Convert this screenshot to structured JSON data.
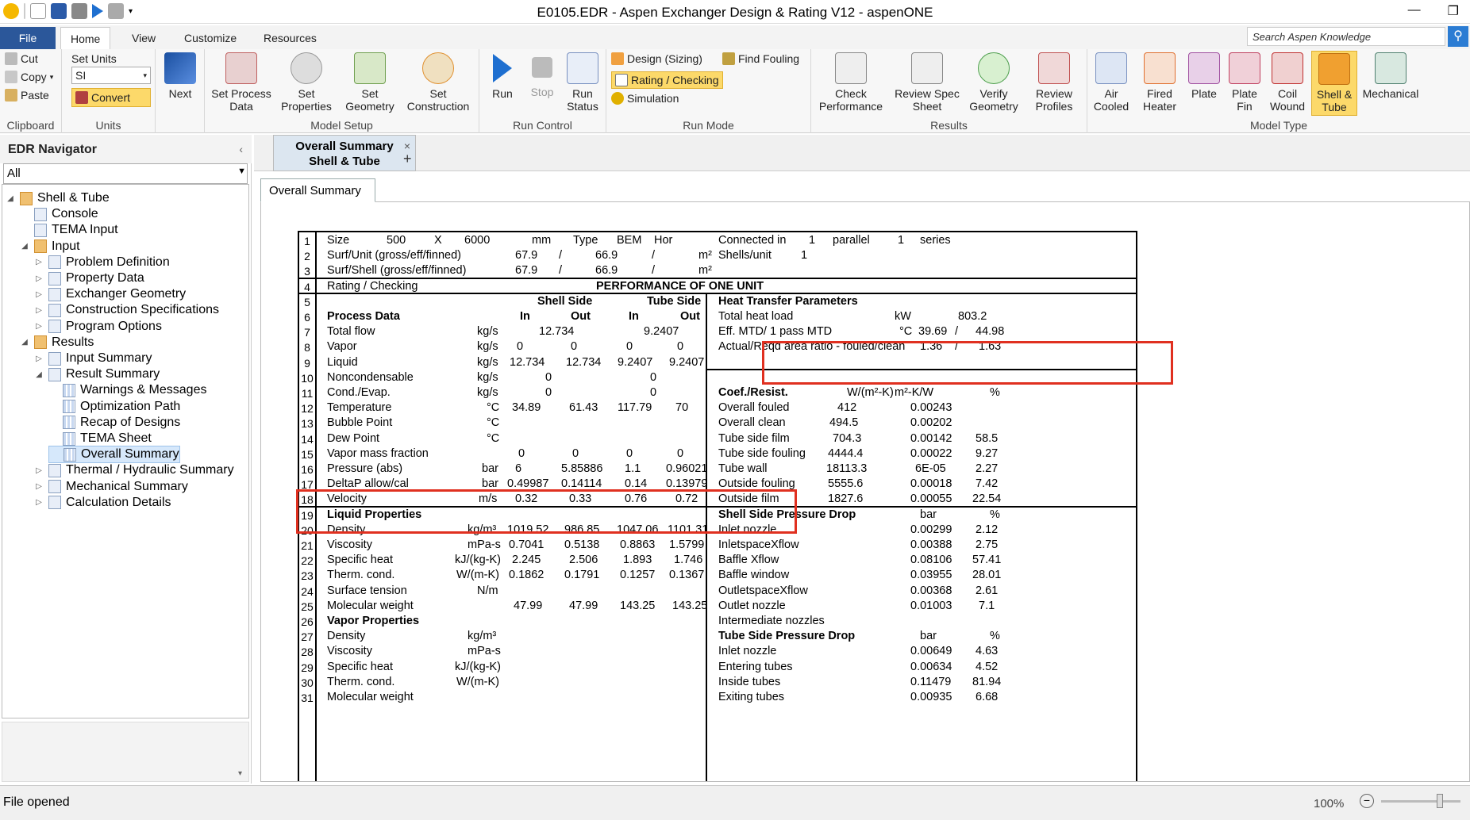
{
  "titlebar": {
    "title": "E0105.EDR - Aspen Exchanger Design & Rating V12 - aspenONE",
    "restore": "❐",
    "minimize": "—"
  },
  "ribbon_tabs": {
    "file": "File",
    "home": "Home",
    "view": "View",
    "customize": "Customize",
    "resources": "Resources"
  },
  "search": {
    "placeholder": "Search Aspen Knowledge"
  },
  "clipboard": {
    "cut": "Cut",
    "copy": "Copy",
    "paste": "Paste",
    "label": "Clipboard"
  },
  "units": {
    "set_units": "Set Units",
    "value": "SI",
    "convert": "Convert",
    "label": "Units"
  },
  "next": "Next",
  "model_setup": {
    "process": "Set Process\nData",
    "properties": "Set\nProperties",
    "geometry": "Set\nGeometry",
    "construction": "Set\nConstruction",
    "label": "Model Setup"
  },
  "run_control": {
    "run": "Run",
    "stop": "Stop",
    "status": "Run\nStatus",
    "label": "Run Control"
  },
  "run_mode": {
    "design": "Design (Sizing)",
    "rating": "Rating / Checking",
    "simulation": "Simulation",
    "find_fouling": "Find Fouling",
    "label": "Run Mode"
  },
  "results": {
    "check": "Check\nPerformance",
    "review_spec": "Review Spec\nSheet",
    "verify": "Verify\nGeometry",
    "review_profiles": "Review\nProfiles",
    "label": "Results"
  },
  "model_type": {
    "air": "Air\nCooled",
    "fired": "Fired\nHeater",
    "plate": "Plate",
    "platefin": "Plate\nFin",
    "coil": "Coil\nWound",
    "shelltube": "Shell &\nTube",
    "mechanical": "Mechanical",
    "label": "Model Type"
  },
  "navigator": {
    "title": "EDR Navigator",
    "collapse": "‹",
    "filter": "All"
  },
  "tree": [
    {
      "label": "Shell & Tube",
      "level": 0,
      "arrow": "◢",
      "icon": "folder"
    },
    {
      "label": "Console",
      "level": 1,
      "arrow": "",
      "icon": "doc"
    },
    {
      "label": "TEMA Input",
      "level": 1,
      "arrow": "",
      "icon": "doc"
    },
    {
      "label": "Input",
      "level": 1,
      "arrow": "◢",
      "icon": "folder"
    },
    {
      "label": "Problem Definition",
      "level": 2,
      "arrow": "▷",
      "icon": "doc"
    },
    {
      "label": "Property Data",
      "level": 2,
      "arrow": "▷",
      "icon": "doc"
    },
    {
      "label": "Exchanger Geometry",
      "level": 2,
      "arrow": "▷",
      "icon": "doc"
    },
    {
      "label": "Construction Specifications",
      "level": 2,
      "arrow": "▷",
      "icon": "doc"
    },
    {
      "label": "Program Options",
      "level": 2,
      "arrow": "▷",
      "icon": "doc"
    },
    {
      "label": "Results",
      "level": 1,
      "arrow": "◢",
      "icon": "folder"
    },
    {
      "label": "Input Summary",
      "level": 2,
      "arrow": "▷",
      "icon": "doc"
    },
    {
      "label": "Result Summary",
      "level": 2,
      "arrow": "◢",
      "icon": "doc"
    },
    {
      "label": "Warnings & Messages",
      "level": 3,
      "arrow": "",
      "icon": "grid"
    },
    {
      "label": "Optimization Path",
      "level": 3,
      "arrow": "",
      "icon": "grid"
    },
    {
      "label": "Recap of Designs",
      "level": 3,
      "arrow": "",
      "icon": "grid"
    },
    {
      "label": "TEMA Sheet",
      "level": 3,
      "arrow": "",
      "icon": "grid"
    },
    {
      "label": "Overall Summary",
      "level": 3,
      "arrow": "",
      "icon": "grid",
      "selected": true
    },
    {
      "label": "Thermal / Hydraulic Summary",
      "level": 2,
      "arrow": "▷",
      "icon": "doc"
    },
    {
      "label": "Mechanical Summary",
      "level": 2,
      "arrow": "▷",
      "icon": "doc"
    },
    {
      "label": "Calculation Details",
      "level": 2,
      "arrow": "▷",
      "icon": "doc"
    }
  ],
  "doc_tab": {
    "line1": "Overall Summary",
    "line2": "Shell & Tube",
    "close": "×",
    "add": "+"
  },
  "sub_tab": "Overall Summary",
  "sheet_rows": [
    {
      "n": "1",
      "cells": [
        [
          "Size",
          35
        ],
        [
          "500",
          110
        ],
        [
          "X",
          170
        ],
        [
          "6000",
          208
        ],
        [
          "mm",
          293
        ],
        [
          "Type",
          345
        ],
        [
          "BEM",
          400
        ],
        [
          "Hor",
          447
        ],
        [
          "Connected in",
          528
        ],
        [
          "1",
          642
        ],
        [
          "parallel",
          672
        ],
        [
          "1",
          754
        ],
        [
          "series",
          782
        ]
      ]
    },
    {
      "n": "2",
      "cells": [
        [
          "Surf/Unit (gross/eff/finned)",
          35
        ],
        [
          "67.9",
          272
        ],
        [
          "/",
          327
        ],
        [
          "66.9",
          373
        ],
        [
          "/",
          444
        ],
        [
          "m²",
          503
        ],
        [
          "Shells/unit",
          528
        ],
        [
          "1",
          632
        ]
      ]
    },
    {
      "n": "3",
      "cells": [
        [
          "Surf/Shell (gross/eff/finned)",
          35
        ],
        [
          "67.9",
          272
        ],
        [
          "/",
          327
        ],
        [
          "66.9",
          373
        ],
        [
          "/",
          444
        ],
        [
          "m²",
          503
        ]
      ]
    },
    {
      "n": "4",
      "cells": [
        [
          "Rating / Checking",
          35
        ]
      ],
      "bold": [
        [
          "PERFORMANCE OF ONE UNIT",
          374
        ]
      ]
    },
    {
      "n": "5",
      "bold": [
        [
          "Shell Side",
          300
        ],
        [
          "Tube Side",
          438
        ],
        [
          "Heat Transfer Parameters",
          528
        ]
      ]
    },
    {
      "n": "6",
      "bold": [
        [
          "Process Data",
          35
        ],
        [
          "In",
          278
        ],
        [
          "Out",
          342
        ],
        [
          "In",
          415
        ],
        [
          "Out",
          480
        ]
      ],
      "cells": [
        [
          "Total heat load",
          528
        ],
        [
          "kW",
          750
        ],
        [
          "803.2",
          830
        ]
      ]
    },
    {
      "n": "7",
      "cells": [
        [
          "Total flow",
          35
        ],
        [
          "kg/s",
          224
        ],
        [
          "12.734",
          302
        ],
        [
          "9.2407",
          434
        ],
        [
          "Eff. MTD/ 1 pass MTD",
          528
        ],
        [
          "°C",
          756
        ],
        [
          "39.69",
          780
        ],
        [
          "/",
          826
        ],
        [
          "44.98",
          852
        ]
      ]
    },
    {
      "n": "8",
      "cells": [
        [
          "Vapor",
          35
        ],
        [
          "kg/s",
          224
        ],
        [
          "0",
          274
        ],
        [
          "0",
          342
        ],
        [
          "0",
          412
        ],
        [
          "0",
          476
        ],
        [
          "Actual/Reqd area ratio - fouled/clean",
          528
        ],
        [
          "1.36",
          782
        ],
        [
          "/",
          826
        ],
        [
          "1.63",
          856
        ]
      ]
    },
    {
      "n": "9",
      "cells": [
        [
          "Liquid",
          35
        ],
        [
          "kg/s",
          224
        ],
        [
          "12.734",
          265
        ],
        [
          "12.734",
          336
        ],
        [
          "9.2407",
          401
        ],
        [
          "9.2407",
          466
        ]
      ]
    },
    {
      "n": "10",
      "cells": [
        [
          "Noncondensable",
          35
        ],
        [
          "kg/s",
          224
        ],
        [
          "0",
          310
        ],
        [
          "0",
          442
        ]
      ]
    },
    {
      "n": "11",
      "cells": [
        [
          "Cond./Evap.",
          35
        ],
        [
          "kg/s",
          224
        ],
        [
          "0",
          310
        ],
        [
          "0",
          442
        ]
      ],
      "bold": [
        [
          "Coef./Resist.",
          528
        ]
      ],
      "cells2": [
        [
          "W/(m²-K)",
          690
        ],
        [
          "m²-K/W",
          750
        ],
        [
          "%",
          870
        ]
      ]
    },
    {
      "n": "12",
      "cells": [
        [
          "Temperature",
          35
        ],
        [
          "°C",
          236
        ],
        [
          "34.89",
          268
        ],
        [
          "61.43",
          340
        ],
        [
          "117.79",
          401
        ],
        [
          "70",
          474
        ],
        [
          "Overall fouled",
          528
        ],
        [
          "412",
          678
        ],
        [
          "0.00243",
          770
        ]
      ]
    },
    {
      "n": "13",
      "cells": [
        [
          "Bubble Point",
          35
        ],
        [
          "°C",
          236
        ],
        [
          "Overall clean",
          528
        ],
        [
          "494.5",
          668
        ],
        [
          "0.00202",
          770
        ]
      ]
    },
    {
      "n": "14",
      "cells": [
        [
          "Dew Point",
          35
        ],
        [
          "°C",
          236
        ],
        [
          "Tube side film",
          528
        ],
        [
          "704.3",
          672
        ],
        [
          "0.00142",
          770
        ],
        [
          "58.5",
          852
        ]
      ]
    },
    {
      "n": "15",
      "cells": [
        [
          "Vapor mass fraction",
          35
        ],
        [
          "0",
          276
        ],
        [
          "0",
          344
        ],
        [
          "0",
          412
        ],
        [
          "0",
          476
        ],
        [
          "Tube side fouling",
          528
        ],
        [
          "4444.4",
          666
        ],
        [
          "0.00022",
          770
        ],
        [
          "9.27",
          852
        ]
      ]
    },
    {
      "n": "16",
      "cells": [
        [
          "Pressure (abs)",
          35
        ],
        [
          "bar",
          230
        ],
        [
          "6",
          272
        ],
        [
          "5.85886",
          330
        ],
        [
          "1.1",
          410
        ],
        [
          "0.96021",
          462
        ],
        [
          "Tube wall",
          528
        ],
        [
          "18113.3",
          664
        ],
        [
          "6E-05",
          776
        ],
        [
          "2.27",
          852
        ]
      ]
    },
    {
      "n": "17",
      "cells": [
        [
          "DeltaP allow/cal",
          35
        ],
        [
          "bar",
          230
        ],
        [
          "0.49987",
          262
        ],
        [
          "0.14114",
          330
        ],
        [
          "0.14",
          410
        ],
        [
          "0.13979",
          462
        ],
        [
          "Outside fouling",
          528
        ],
        [
          "5555.6",
          666
        ],
        [
          "0.00018",
          770
        ],
        [
          "7.42",
          852
        ]
      ]
    },
    {
      "n": "18",
      "cells": [
        [
          "Velocity",
          35
        ],
        [
          "m/s",
          226
        ],
        [
          "0.32",
          272
        ],
        [
          "0.33",
          340
        ],
        [
          "0.76",
          410
        ],
        [
          "0.72",
          474
        ],
        [
          "Outside film",
          528
        ],
        [
          "1827.6",
          666
        ],
        [
          "0.00055",
          770
        ],
        [
          "22.54",
          848
        ]
      ]
    },
    {
      "n": "19",
      "bold": [
        [
          "Liquid Properties",
          35
        ],
        [
          "Shell Side Pressure Drop",
          528
        ]
      ],
      "cells": [
        [
          "bar",
          782
        ],
        [
          "%",
          870
        ]
      ]
    },
    {
      "n": "20",
      "cells": [
        [
          "Density",
          35
        ],
        [
          "kg/m³",
          212
        ],
        [
          "1019.52",
          262
        ],
        [
          "986.85",
          334
        ],
        [
          "1047.06",
          400
        ],
        [
          "1101.31",
          464
        ],
        [
          "Inlet nozzle",
          528
        ],
        [
          "0.00299",
          770
        ],
        [
          "2.12",
          852
        ]
      ]
    },
    {
      "n": "21",
      "cells": [
        [
          "Viscosity",
          35
        ],
        [
          "mPa-s",
          212
        ],
        [
          "0.7041",
          264
        ],
        [
          "0.5138",
          334
        ],
        [
          "0.8863",
          404
        ],
        [
          "1.5799",
          466
        ],
        [
          "InletspaceXflow",
          528
        ],
        [
          "0.00388",
          770
        ],
        [
          "2.75",
          852
        ]
      ]
    },
    {
      "n": "22",
      "cells": [
        [
          "Specific heat",
          35
        ],
        [
          "kJ/(kg-K)",
          196
        ],
        [
          "2.245",
          268
        ],
        [
          "2.506",
          340
        ],
        [
          "1.893",
          408
        ],
        [
          "1.746",
          472
        ],
        [
          "Baffle Xflow",
          528
        ],
        [
          "0.08106",
          770
        ],
        [
          "57.41",
          848
        ]
      ]
    },
    {
      "n": "23",
      "cells": [
        [
          "Therm. cond.",
          35
        ],
        [
          "W/(m-K)",
          198
        ],
        [
          "0.1862",
          264
        ],
        [
          "0.1791",
          334
        ],
        [
          "0.1257",
          404
        ],
        [
          "0.1367",
          466
        ],
        [
          "Baffle window",
          528
        ],
        [
          "0.03955",
          770
        ],
        [
          "28.01",
          848
        ]
      ]
    },
    {
      "n": "24",
      "cells": [
        [
          "Surface tension",
          35
        ],
        [
          "N/m",
          224
        ],
        [
          "OutletspaceXflow",
          528
        ],
        [
          "0.00368",
          770
        ],
        [
          "2.61",
          852
        ]
      ]
    },
    {
      "n": "25",
      "cells": [
        [
          "Molecular weight",
          35
        ],
        [
          "47.99",
          270
        ],
        [
          "47.99",
          340
        ],
        [
          "143.25",
          404
        ],
        [
          "143.25",
          470
        ],
        [
          "Outlet nozzle",
          528
        ],
        [
          "0.01003",
          770
        ],
        [
          "7.1",
          856
        ]
      ]
    },
    {
      "n": "26",
      "bold": [
        [
          "Vapor Properties",
          35
        ]
      ],
      "cells": [
        [
          "Intermediate nozzles",
          528
        ]
      ]
    },
    {
      "n": "27",
      "cells": [
        [
          "Density",
          35
        ],
        [
          "kg/m³",
          212
        ],
        [
          "bar",
          782
        ],
        [
          "%",
          870
        ]
      ],
      "bold": [
        [
          "Tube Side Pressure Drop",
          528
        ]
      ]
    },
    {
      "n": "28",
      "cells": [
        [
          "Viscosity",
          35
        ],
        [
          "mPa-s",
          212
        ],
        [
          "Inlet nozzle",
          528
        ],
        [
          "0.00649",
          770
        ],
        [
          "4.63",
          852
        ]
      ]
    },
    {
      "n": "29",
      "cells": [
        [
          "Specific heat",
          35
        ],
        [
          "kJ/(kg-K)",
          196
        ],
        [
          "Entering tubes",
          528
        ],
        [
          "0.00634",
          770
        ],
        [
          "4.52",
          852
        ]
      ]
    },
    {
      "n": "30",
      "cells": [
        [
          "Therm. cond.",
          35
        ],
        [
          "W/(m-K)",
          198
        ],
        [
          "Inside tubes",
          528
        ],
        [
          "0.11479",
          770
        ],
        [
          "81.94",
          848
        ]
      ]
    },
    {
      "n": "31",
      "cells": [
        [
          "Molecular weight",
          35
        ],
        [
          "Exiting tubes",
          528
        ],
        [
          "0.00935",
          770
        ],
        [
          "6.68",
          852
        ]
      ]
    }
  ],
  "status": {
    "text": "File opened",
    "zoom": "100%",
    "zoom_minus": "−"
  }
}
